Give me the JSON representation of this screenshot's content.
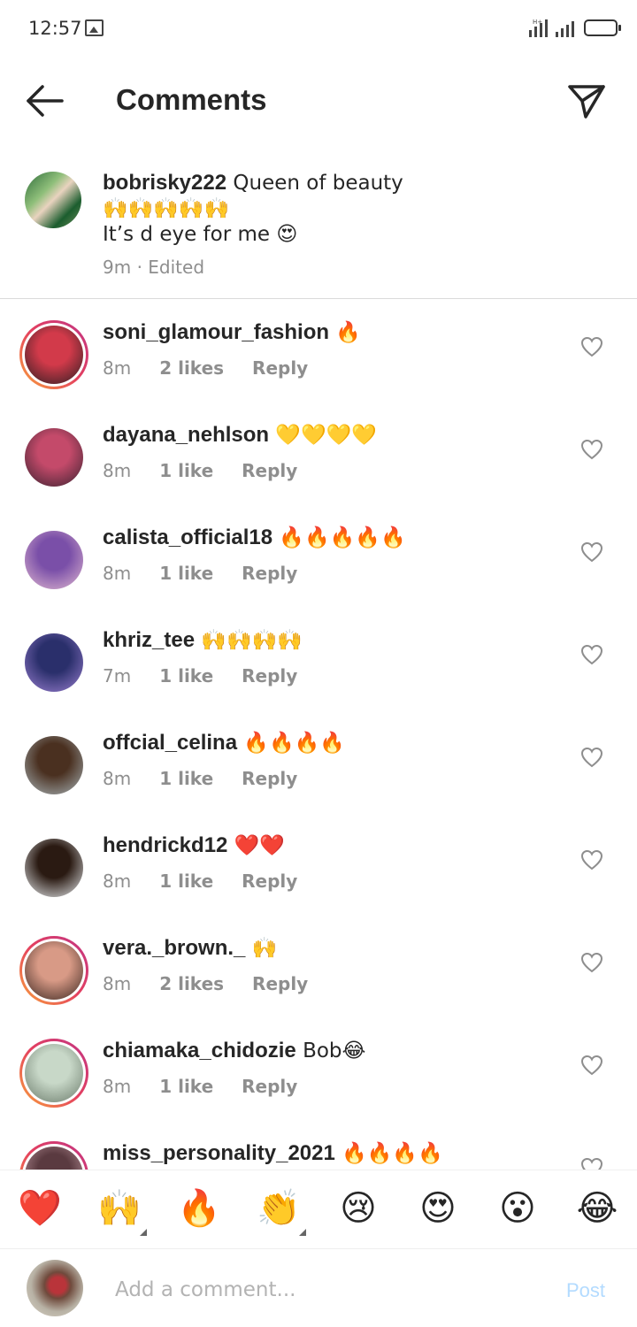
{
  "status_bar": {
    "time": "12:57"
  },
  "header": {
    "title": "Comments"
  },
  "caption": {
    "username": "bobrisky222",
    "text_line1": "Queen of beauty",
    "text_line2": "🙌🙌🙌🙌🙌",
    "text_line3": "It’s d eye for me 😍",
    "time": "9m",
    "edited": "· Edited"
  },
  "comments": [
    {
      "username": "soni_glamour_fashion",
      "text": "🔥",
      "time": "8m",
      "likes": "2 likes",
      "reply": "Reply",
      "story_ring": true,
      "avatar_colors": [
        "#d23a4a",
        "#2b1e22"
      ]
    },
    {
      "username": "dayana_nehlson",
      "text": "💛💛💛💛",
      "time": "8m",
      "likes": "1 like",
      "reply": "Reply",
      "story_ring": false,
      "avatar_colors": [
        "#c44a6a",
        "#3a2230"
      ]
    },
    {
      "username": "calista_official18",
      "text": "🔥🔥🔥🔥🔥",
      "time": "8m",
      "likes": "1 like",
      "reply": "Reply",
      "story_ring": false,
      "avatar_colors": [
        "#7a4fa8",
        "#e0b8d0"
      ]
    },
    {
      "username": "khriz_tee",
      "text": "🙌🙌🙌🙌",
      "time": "7m",
      "likes": "1 like",
      "reply": "Reply",
      "story_ring": false,
      "avatar_colors": [
        "#2a2f6b",
        "#9a7fd0"
      ]
    },
    {
      "username": "offcial_celina",
      "text": "🔥🔥🔥🔥",
      "time": "8m",
      "likes": "1 like",
      "reply": "Reply",
      "story_ring": false,
      "avatar_colors": [
        "#4a3020",
        "#a8b4b8"
      ]
    },
    {
      "username": "hendrickd12",
      "text": "❤️❤️",
      "time": "8m",
      "likes": "1 like",
      "reply": "Reply",
      "story_ring": false,
      "avatar_colors": [
        "#2a1a12",
        "#e8ecef"
      ]
    },
    {
      "username": "vera._brown._",
      "text": "🙌",
      "time": "8m",
      "likes": "2 likes",
      "reply": "Reply",
      "story_ring": true,
      "avatar_colors": [
        "#d89a86",
        "#3a2620"
      ]
    },
    {
      "username": "chiamaka_chidozie",
      "text": "Bob😂",
      "time": "8m",
      "likes": "1 like",
      "reply": "Reply",
      "story_ring": true,
      "avatar_colors": [
        "#c8d8c8",
        "#6a7a6a"
      ]
    },
    {
      "username": "miss_personality_2021",
      "text": "🔥🔥🔥🔥",
      "time": "",
      "likes": "",
      "reply": "",
      "story_ring": true,
      "avatar_colors": [
        "#5a3a40",
        "#c8a0a8"
      ]
    }
  ],
  "quick_reactions": [
    "❤️",
    "🙌",
    "🔥",
    "👏",
    "😢",
    "😍",
    "😮",
    "😂"
  ],
  "composer": {
    "placeholder": "Add a comment...",
    "post_label": "Post"
  },
  "colors": {
    "text_primary": "#262626",
    "text_secondary": "#8e8e8e",
    "post_disabled": "#b3dbff",
    "divider": "#dbdbdb"
  }
}
